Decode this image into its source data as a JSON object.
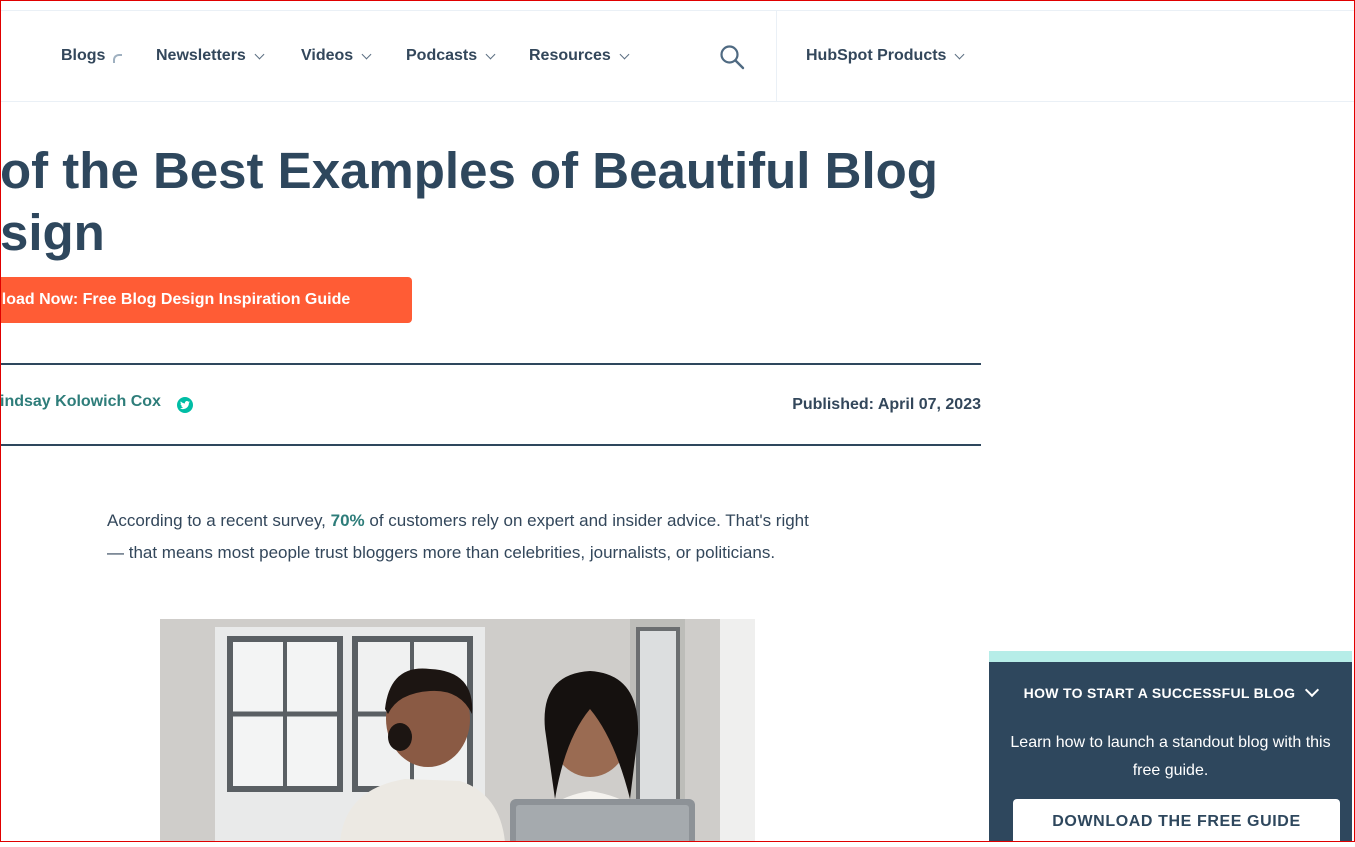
{
  "nav": {
    "items": [
      {
        "label": "Blogs"
      },
      {
        "label": "Newsletters"
      },
      {
        "label": "Videos"
      },
      {
        "label": "Podcasts"
      },
      {
        "label": "Resources"
      }
    ],
    "products_label": "HubSpot Products"
  },
  "article": {
    "title": "of the Best Examples of Beautiful Blog\nsign",
    "cta_label": "nload Now: Free Blog Design Inspiration Guide",
    "author": "indsay Kolowich Cox",
    "published": "Published: April 07, 2023",
    "intro_before": "According to a recent survey, ",
    "intro_stat": "70%",
    "intro_after": " of customers rely on expert and insider advice. That's right — that means most people trust bloggers more than celebrities, journalists, or politicians."
  },
  "widget": {
    "title": "HOW TO START A SUCCESSFUL BLOG",
    "description": "Learn how to launch a standout blog with this free guide.",
    "button_label": "DOWNLOAD THE FREE GUIDE"
  },
  "colors": {
    "accent": "#ff5c35",
    "heading": "#2e475d",
    "link_teal": "#2e7d7a",
    "widget_bg": "#2e475d",
    "widget_stripe": "#b6ede8"
  }
}
